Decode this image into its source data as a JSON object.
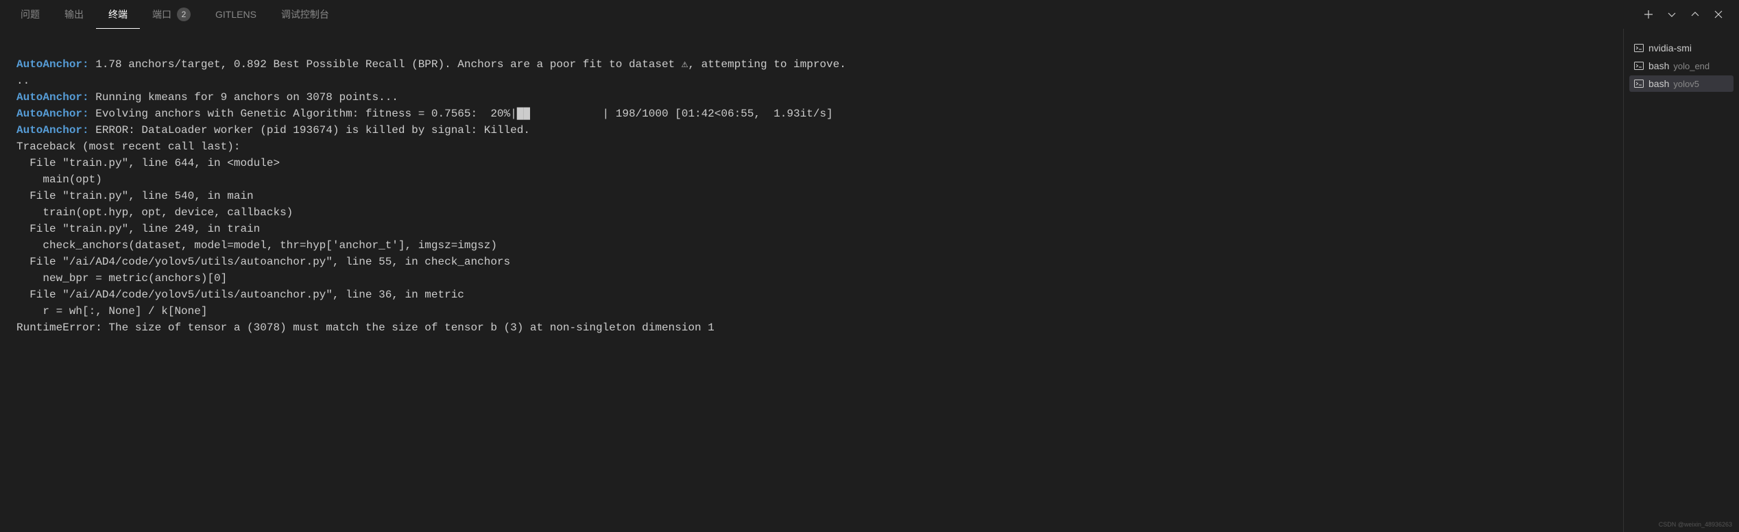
{
  "tabs": {
    "problems": "问题",
    "output": "输出",
    "terminal": "终端",
    "ports": "端口",
    "ports_badge": "2",
    "gitlens": "GITLENS",
    "debug_console": "调试控制台"
  },
  "terminal_list": [
    {
      "name": "nvidia-smi",
      "sub": ""
    },
    {
      "name": "bash",
      "sub": "yolo_end"
    },
    {
      "name": "bash",
      "sub": "yolov5"
    }
  ],
  "terminal_output": {
    "prefix": "AutoAnchor: ",
    "line1_rest": "1.78 anchors/target, 0.892 Best Possible Recall (BPR). Anchors are a poor fit to dataset ⚠, attempting to improve.",
    "line1_cont": "..",
    "line2_rest": "Running kmeans for 9 anchors on 3078 points...",
    "line3_rest": "Evolving anchors with Genetic Algorithm: fitness = 0.7565:  20%|██           | 198/1000 [01:42<06:55,  1.93it/s]",
    "line4_rest": "ERROR: DataLoader worker (pid 193674) is killed by signal: Killed.",
    "traceback": "Traceback (most recent call last):\n  File \"train.py\", line 644, in <module>\n    main(opt)\n  File \"train.py\", line 540, in main\n    train(opt.hyp, opt, device, callbacks)\n  File \"train.py\", line 249, in train\n    check_anchors(dataset, model=model, thr=hyp['anchor_t'], imgsz=imgsz)\n  File \"/ai/AD4/code/yolov5/utils/autoanchor.py\", line 55, in check_anchors\n    new_bpr = metric(anchors)[0]\n  File \"/ai/AD4/code/yolov5/utils/autoanchor.py\", line 36, in metric\n    r = wh[:, None] / k[None]\nRuntimeError: The size of tensor a (3078) must match the size of tensor b (3) at non-singleton dimension 1"
  },
  "watermark": "CSDN @weixin_48936263"
}
